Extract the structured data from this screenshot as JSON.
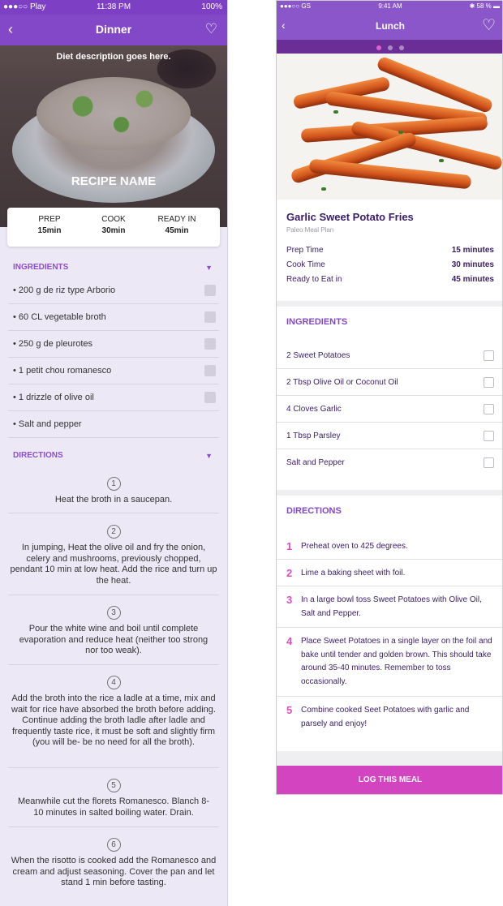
{
  "left_screen": {
    "status_bar": {
      "carrier": "●●●○○ Play",
      "time": "11:38 PM",
      "battery": "100%"
    },
    "header": {
      "title": "Dinner",
      "back_icon": "chevron-left-icon",
      "favorite_icon": "heart-outline-icon"
    },
    "diet_description": "Diet description goes here.",
    "recipe_name": "RECIPE NAME",
    "stats": [
      {
        "label": "PREP",
        "value": "15min"
      },
      {
        "label": "COOK",
        "value": "30min"
      },
      {
        "label": "READY IN",
        "value": "45min"
      }
    ],
    "ingredients_heading": "INGREDIENTS",
    "ingredients": [
      "200 g de riz type Arborio",
      "60 CL vegetable broth",
      "250 g de pleurotes",
      "1 petit chou romanesco",
      "1 drizzle of olive oil",
      "Salt and pepper"
    ],
    "directions_heading": "DIRECTIONS",
    "directions": [
      {
        "number": "1",
        "text": "Heat the broth in a saucepan."
      },
      {
        "number": "2",
        "text": "In jumping, Heat the olive oil and fry the onion, celery and mushrooms, previously chopped, pendant 10 min at low heat. Add the rice and turn up the heat."
      },
      {
        "number": "3",
        "text": "Pour the white wine and boil until complete evaporation and reduce heat (neither too strong nor too weak)."
      },
      {
        "number": "4",
        "text": "Add the broth into the rice a ladle at a time, mix and wait for rice have absorbed the broth before adding. Continue adding the broth ladle after ladle and frequently taste rice, it must be soft and slightly firm (you will be- be no need for all the broth)."
      },
      {
        "number": "5",
        "text": "Meanwhile cut the florets Romanesco. Blanch 8-10 minutes in salted boiling water. Drain."
      },
      {
        "number": "6",
        "text": "When the risotto is cooked add the Romanesco and cream and adjust seasoning. Cover the pan and let stand 1 min before tasting."
      }
    ]
  },
  "right_screen": {
    "status_bar": {
      "carrier": "●●●○○ GS",
      "time": "9:41 AM",
      "battery": "58 %"
    },
    "header": {
      "title": "Lunch",
      "back_icon": "chevron-left-icon",
      "favorite_icon": "heart-outline-icon"
    },
    "carousel": {
      "pages": 3,
      "active": 1
    },
    "recipe": {
      "name": "Garlic Sweet Potato Fries",
      "plan": "Paleo Meal Plan"
    },
    "times": [
      {
        "label": "Prep Time",
        "value": "15 minutes"
      },
      {
        "label": "Cook Time",
        "value": "30 minutes"
      },
      {
        "label": "Ready to Eat in",
        "value": "45 minutes"
      }
    ],
    "ingredients_heading": "INGREDIENTS",
    "ingredients": [
      "2 Sweet Potatoes",
      "2 Tbsp Olive Oil or Coconut Oil",
      "4 Cloves Garlic",
      "1 Tbsp Parsley",
      "Salt and Pepper"
    ],
    "directions_heading": "DIRECTIONS",
    "directions": [
      {
        "number": "1",
        "text": "Preheat oven to 425 degrees."
      },
      {
        "number": "2",
        "text": "Lime a baking sheet with foil."
      },
      {
        "number": "3",
        "text": "In a large bowl toss Sweet Potatoes with Olive Oil, Salt and Pepper."
      },
      {
        "number": "4",
        "text": "Place Sweet Potatoes in a single layer on the foil and bake until tender and golden brown. This should take around 35-40 minutes. Remember to toss occasionally."
      },
      {
        "number": "5",
        "text": "Combine cooked Seet Potatoes with garlic and parsely and enjoy!"
      }
    ],
    "log_button": "LOG THIS MEAL"
  },
  "colors": {
    "purple_header": "#8348c8",
    "purple_dark": "#6b2e96",
    "accent_magenta": "#d244c0",
    "text_dark_purple": "#3a1c66",
    "left_background": "#ede8f5"
  }
}
